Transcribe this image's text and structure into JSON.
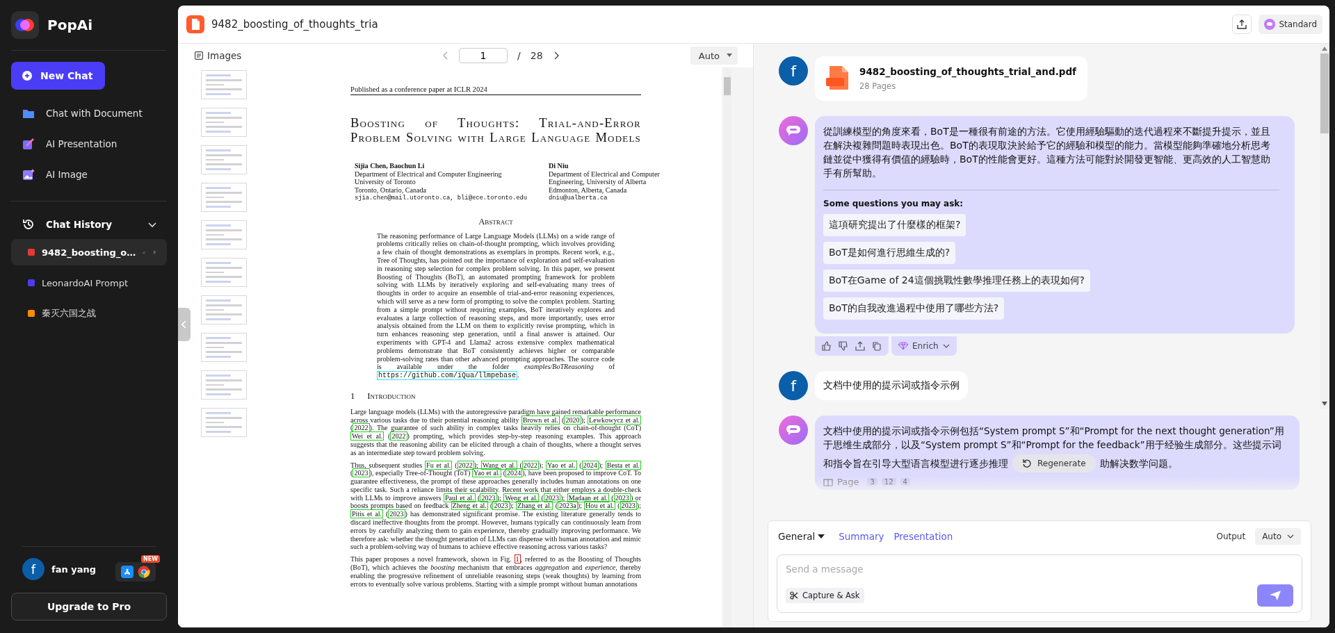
{
  "sidebar": {
    "brand": "PopAi",
    "new_chat": "New Chat",
    "nav": [
      {
        "label": "Chat with Document"
      },
      {
        "label": "AI Presentation"
      },
      {
        "label": "AI Image"
      }
    ],
    "history_title": "Chat History",
    "history_expanded": true,
    "history": [
      {
        "label": "9482_boosting_o…",
        "color": "#e53935",
        "selected": true
      },
      {
        "label": "LeonardoAI Prompt",
        "color": "#4c3cf5",
        "selected": false
      },
      {
        "label": "秦灭六国之战",
        "color": "#ff8c00",
        "selected": false
      }
    ],
    "user": {
      "initial": "f",
      "name": "fan yang"
    },
    "new_badge": "NEW",
    "upgrade": "Upgrade to Pro"
  },
  "header": {
    "file_title": "9482_boosting_of_thoughts_tria",
    "mode": "Standard"
  },
  "viewer": {
    "images_label": "Images",
    "page": "1",
    "page_separator": "/",
    "page_total": "28",
    "zoom": "Auto",
    "document": {
      "running_header": "Published as a conference paper at ICLR 2024",
      "title": "Boosting of Thoughts: Trial-and-Error Problem Solving with Large Language Models",
      "authors": [
        {
          "names": "Sijia Chen, Baochun Li",
          "lines": [
            "Department of Electrical and Computer Engineering",
            "University of Toronto",
            "Toronto, Ontario, Canada"
          ],
          "email": "sjia.chen@mail.utoronto.ca, bli@ece.toronto.edu"
        },
        {
          "names": "Di Niu",
          "lines": [
            "Department of Electrical and Computer",
            "Engineering, University of Alberta",
            "Edmonton, Alberta, Canada"
          ],
          "email": "dniu@ualberta.ca"
        }
      ],
      "abstract_heading": "Abstract",
      "abstract": [
        {
          "kind": "plain",
          "text": "The reasoning performance of Large Language Models (LLMs) on a wide range of problems critically relies on chain-of-thought prompting, which involves providing a few chain of thought demonstrations as exemplars in prompts.  Recent work, e.g., Tree of Thoughts, has pointed out the importance of exploration and self-evaluation in reasoning step selection for complex problem solving. In this paper, we present Boosting of Thoughts (BoT), an automated prompting framework for problem solving with LLMs by iteratively exploring and self-evaluating many trees of thoughts in order to acquire an ensemble of trial-and-error reasoning experiences, which will serve as a new form of prompting to solve the complex problem.  Starting from a simple prompt without requiring examples, BoT iteratively explores and evaluates a large collection of reasoning steps, and more importantly, uses error analysis obtained from the LLM on them to explicitly revise prompting, which in turn enhances reasoning step generation, until a final answer is attained.  Our experiments with GPT-4 and Llama2 across extensive complex mathematical problems demonstrate that BoT consistently achieves higher or comparable problem-solving rates than other advanced prompting approaches. The source code is available under the folder *examples/BoTReasoning* of "
        },
        {
          "kind": "url",
          "text": "https://github.com/iQua/llmpebase"
        },
        {
          "kind": "plain",
          "text": "."
        }
      ],
      "section_number": "1",
      "section_title": "Introduction",
      "paragraphs": [
        [
          {
            "kind": "plain",
            "text": "Large language models (LLMs) with the autoregressive paradigm have gained remarkable performance across various tasks due to their potential reasoning ability "
          },
          {
            "kind": "cite",
            "text": "Brown et al."
          },
          {
            "kind": "plain",
            "text": " ("
          },
          {
            "kind": "cite",
            "text": "2020"
          },
          {
            "kind": "plain",
            "text": "); "
          },
          {
            "kind": "cite",
            "text": "Lewkowycz et al."
          },
          {
            "kind": "plain",
            "text": " ("
          },
          {
            "kind": "cite",
            "text": "2022"
          },
          {
            "kind": "plain",
            "text": "). The guarantee of such ability in complex tasks heavily relies on chain-of-thought (CoT) "
          },
          {
            "kind": "cite",
            "text": "Wei et al."
          },
          {
            "kind": "plain",
            "text": " ("
          },
          {
            "kind": "cite",
            "text": "2022"
          },
          {
            "kind": "plain",
            "text": ") prompting, which provides step-by-step reasoning examples. This approach suggests that the reasoning ability can be elicited through a chain of thoughts, where a thought serves as an intermediate step toward problem solving."
          }
        ],
        [
          {
            "kind": "plain",
            "text": "Thus, subsequent studies "
          },
          {
            "kind": "cite",
            "text": "Fu et al."
          },
          {
            "kind": "plain",
            "text": " ("
          },
          {
            "kind": "cite",
            "text": "2022"
          },
          {
            "kind": "plain",
            "text": "); "
          },
          {
            "kind": "cite",
            "text": "Wang et al."
          },
          {
            "kind": "plain",
            "text": " ("
          },
          {
            "kind": "cite",
            "text": "2022"
          },
          {
            "kind": "plain",
            "text": "); "
          },
          {
            "kind": "cite",
            "text": "Yao et al."
          },
          {
            "kind": "plain",
            "text": " ("
          },
          {
            "kind": "cite",
            "text": "2024"
          },
          {
            "kind": "plain",
            "text": "); "
          },
          {
            "kind": "cite",
            "text": "Besta et al."
          },
          {
            "kind": "plain",
            "text": " ("
          },
          {
            "kind": "cite",
            "text": "2023"
          },
          {
            "kind": "plain",
            "text": "), especially Tree-of-Thought (ToT) "
          },
          {
            "kind": "cite",
            "text": "Yao et al."
          },
          {
            "kind": "plain",
            "text": " ("
          },
          {
            "kind": "cite",
            "text": "2024"
          },
          {
            "kind": "plain",
            "text": "), have been proposed to improve CoT. To guarantee effectiveness, the prompt of these approaches generally includes human annotations on one specific task. Such a reliance limits their scalability. Recent work that either employs a double-check with LLMs to improve answers "
          },
          {
            "kind": "cite",
            "text": "Paul et al."
          },
          {
            "kind": "plain",
            "text": " ("
          },
          {
            "kind": "cite",
            "text": "2023"
          },
          {
            "kind": "plain",
            "text": "); "
          },
          {
            "kind": "cite",
            "text": "Weng et al."
          },
          {
            "kind": "plain",
            "text": " ("
          },
          {
            "kind": "cite",
            "text": "2023"
          },
          {
            "kind": "plain",
            "text": "); "
          },
          {
            "kind": "cite",
            "text": "Madaan et al."
          },
          {
            "kind": "plain",
            "text": " ("
          },
          {
            "kind": "cite",
            "text": "2023"
          },
          {
            "kind": "plain",
            "text": ") or boosts prompts based on feedback "
          },
          {
            "kind": "cite",
            "text": "Zheng et al."
          },
          {
            "kind": "plain",
            "text": " ("
          },
          {
            "kind": "cite",
            "text": "2023"
          },
          {
            "kind": "plain",
            "text": "); "
          },
          {
            "kind": "cite",
            "text": "Zhang et al."
          },
          {
            "kind": "plain",
            "text": " ("
          },
          {
            "kind": "cite",
            "text": "2023a"
          },
          {
            "kind": "plain",
            "text": "); "
          },
          {
            "kind": "cite",
            "text": "Hou et al."
          },
          {
            "kind": "plain",
            "text": " ("
          },
          {
            "kind": "cite",
            "text": "2023"
          },
          {
            "kind": "plain",
            "text": "); "
          },
          {
            "kind": "cite",
            "text": "Pitis et al."
          },
          {
            "kind": "plain",
            "text": " ("
          },
          {
            "kind": "cite",
            "text": "2023"
          },
          {
            "kind": "plain",
            "text": ") has demonstrated significant promise.  The existing literature generally tends to discard ineffective thoughts from the prompt. However, humans typically can continuously learn from errors by carefully analyzing them to gain experience, thereby gradually improving performance.  We therefore ask: whether the thought generation of LLMs can dispense with human annotation and mimic such a problem-solving way of humans to achieve effective reasoning across various tasks?"
          }
        ],
        [
          {
            "kind": "plain",
            "text": "This paper proposes a novel framework, shown in Fig. "
          },
          {
            "kind": "ref",
            "text": "1"
          },
          {
            "kind": "plain",
            "text": ", referred to as the Boosting of Thoughts (BoT), which achieves the *boosting* mechanism that embraces *aggregation* and *experience*, thereby enabling the progressive refinement of unreliable reasoning steps (weak thoughts) by learning from errors to eventually solve various problems. Starting with a simple prompt without human annotations"
          }
        ]
      ]
    }
  },
  "chat": {
    "file_message": {
      "avatar": "f",
      "file_name": "9482_boosting_of_thoughts_trial_and.pdf",
      "file_meta": "28 Pages"
    },
    "answer": {
      "text": "從訓練模型的角度來看，BoT是一種很有前途的方法。它使用經驗驅動的迭代過程來不斷提升提示，並且在解決複雜問題時表現出色。BoT的表現取決於給予它的經驗和模型的能力。當模型能夠準確地分析思考鏈並從中獲得有價值的經驗時，BoT的性能會更好。這種方法可能對於開發更智能、更高效的人工智慧助手有所幫助。",
      "suggest_title": "Some questions you may ask:",
      "suggestions": [
        "這項研究提出了什麼樣的框架?",
        "BoT是如何進行思維生成的?",
        "BoT在Game of 24這個挑戰性數學推理任務上的表現如何?",
        "BoT的自我改進過程中使用了哪些方法?"
      ],
      "enrich": "Enrich"
    },
    "question": {
      "avatar": "f",
      "text": "文档中使用的提示词或指令示例"
    },
    "answer2": {
      "lines": [
        "文档中使用的提示词或指令示例包括“System prompt S”和“Prompt for the next thought generation”用",
        "于思维生成部分，以及“System prompt S”和“Prompt for the feedback”用于经验生成部分。这些提示词"
      ],
      "text_before": "和指令旨在引导大型语言模型进行逐步推理",
      "regenerate": "Regenerate",
      "text_after": "助解决数学问题。",
      "page_label": "Page",
      "pages": [
        "3",
        "12",
        "4"
      ]
    }
  },
  "composer": {
    "mode": "General",
    "quick_actions": [
      "Summary",
      "Presentation"
    ],
    "output_label": "Output",
    "output_value": "Auto",
    "placeholder": "Send a message",
    "capture": "Capture & Ask"
  }
}
